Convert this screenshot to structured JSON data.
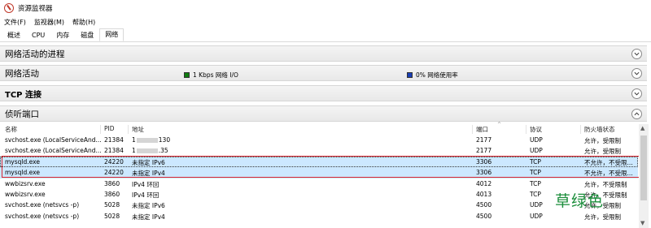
{
  "window": {
    "title": "资源监视器"
  },
  "menu": [
    "文件(F)",
    "监视器(M)",
    "帮助(H)"
  ],
  "tabs": [
    {
      "label": "概述",
      "active": false
    },
    {
      "label": "CPU",
      "active": false
    },
    {
      "label": "内存",
      "active": false
    },
    {
      "label": "磁盘",
      "active": false
    },
    {
      "label": "网络",
      "active": true
    }
  ],
  "sections": {
    "processes": "网络活动的进程",
    "activity": "网络活动",
    "tcp": "TCP 连接",
    "listening": "侦听端口"
  },
  "legend": {
    "io_label": "1 Kbps 网络 I/O",
    "io_color": "#107c10",
    "usage_label": "0% 网络使用率",
    "usage_color": "#1a3fb5"
  },
  "table": {
    "headers": [
      "名称",
      "PID",
      "地址",
      "端口",
      "协议",
      "防火墙状态"
    ],
    "rows": [
      {
        "name": "svchost.exe (LocalServiceAnd...",
        "pid": "21384",
        "addr_a": "1",
        "addr_b": "130",
        "port": "2177",
        "proto": "UDP",
        "fw": "允许，受限制"
      },
      {
        "name": "svchost.exe (LocalServiceAnd...",
        "pid": "21384",
        "addr_a": "1",
        "addr_b": ".35",
        "port": "2177",
        "proto": "UDP",
        "fw": "允许，受限制"
      },
      {
        "name": "mysqld.exe",
        "pid": "24220",
        "addr": "未指定 IPv6",
        "port": "3306",
        "proto": "TCP",
        "fw": "不允许，不受限..."
      },
      {
        "name": "mysqld.exe",
        "pid": "24220",
        "addr": "未指定 IPv4",
        "port": "3306",
        "proto": "TCP",
        "fw": "不允许，不受限..."
      },
      {
        "name": "wwbizsrv.exe",
        "pid": "3860",
        "addr": "IPv4 环回",
        "port": "4012",
        "proto": "TCP",
        "fw": "允许，不受限制"
      },
      {
        "name": "wwbizsrv.exe",
        "pid": "3860",
        "addr": "IPv4 环回",
        "port": "4013",
        "proto": "TCP",
        "fw": "允许，不受限制"
      },
      {
        "name": "svchost.exe (netsvcs -p)",
        "pid": "5028",
        "addr": "未指定 IPv6",
        "port": "4500",
        "proto": "UDP",
        "fw": "允许，受限制"
      },
      {
        "name": "svchost.exe (netsvcs -p)",
        "pid": "5028",
        "addr": "未指定 IPv4",
        "port": "4500",
        "proto": "UDP",
        "fw": "允许，受限制"
      }
    ]
  },
  "watermark": "草绿色"
}
